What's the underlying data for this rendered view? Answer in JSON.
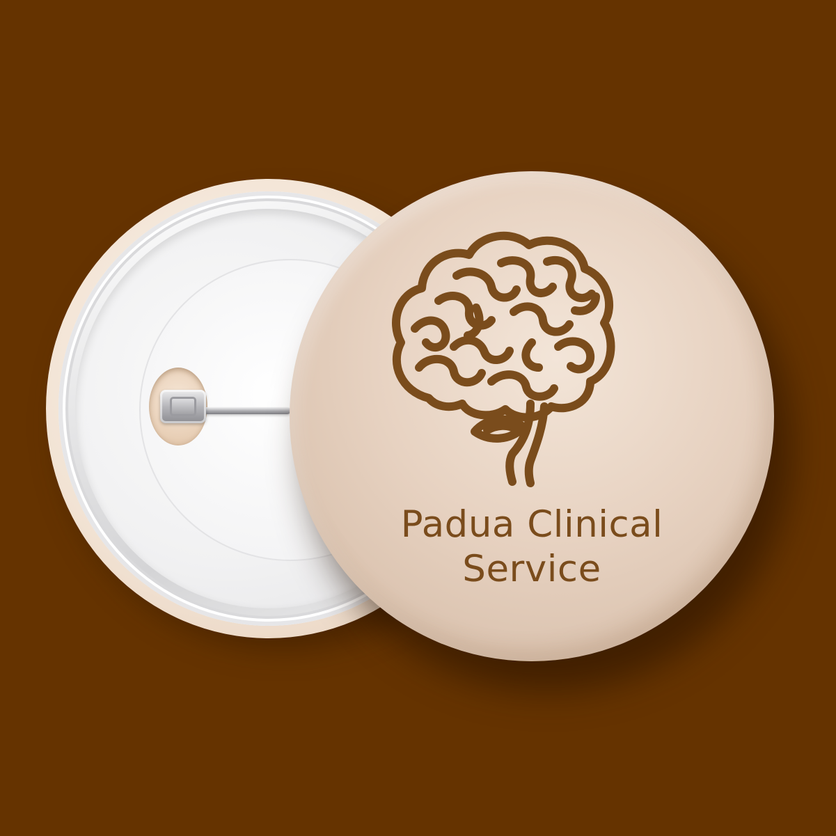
{
  "badge": {
    "title_line1": "Padua Clinical",
    "title_line2": "Service",
    "logo_icon": "brain-icon"
  },
  "colors": {
    "background": "#653300",
    "badge_face": "#e7d2c1",
    "logo_and_text": "#7a4c1c",
    "back_metal": "#f1f1f2"
  }
}
